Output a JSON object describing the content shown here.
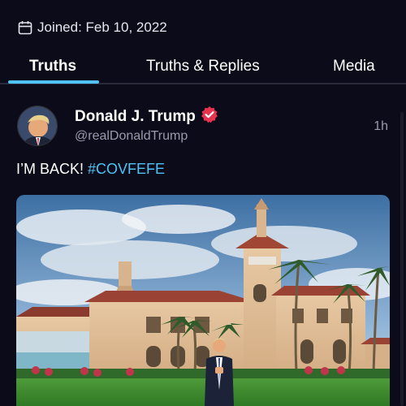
{
  "profile": {
    "joined_label": "Joined: Feb 10, 2022"
  },
  "tabs": [
    {
      "label": "Truths",
      "active": true
    },
    {
      "label": "Truths & Replies",
      "active": false
    },
    {
      "label": "Media",
      "active": false
    }
  ],
  "post": {
    "display_name": "Donald J. Trump",
    "handle": "@realDonaldTrump",
    "timestamp": "1h",
    "text": "I’M BACK!",
    "hashtag": "#COVFEFE",
    "verified_icon": "verified-badge-icon"
  },
  "colors": {
    "background": "#0c0b1a",
    "accent": "#4fc3f7",
    "verified": "#e8334f"
  }
}
